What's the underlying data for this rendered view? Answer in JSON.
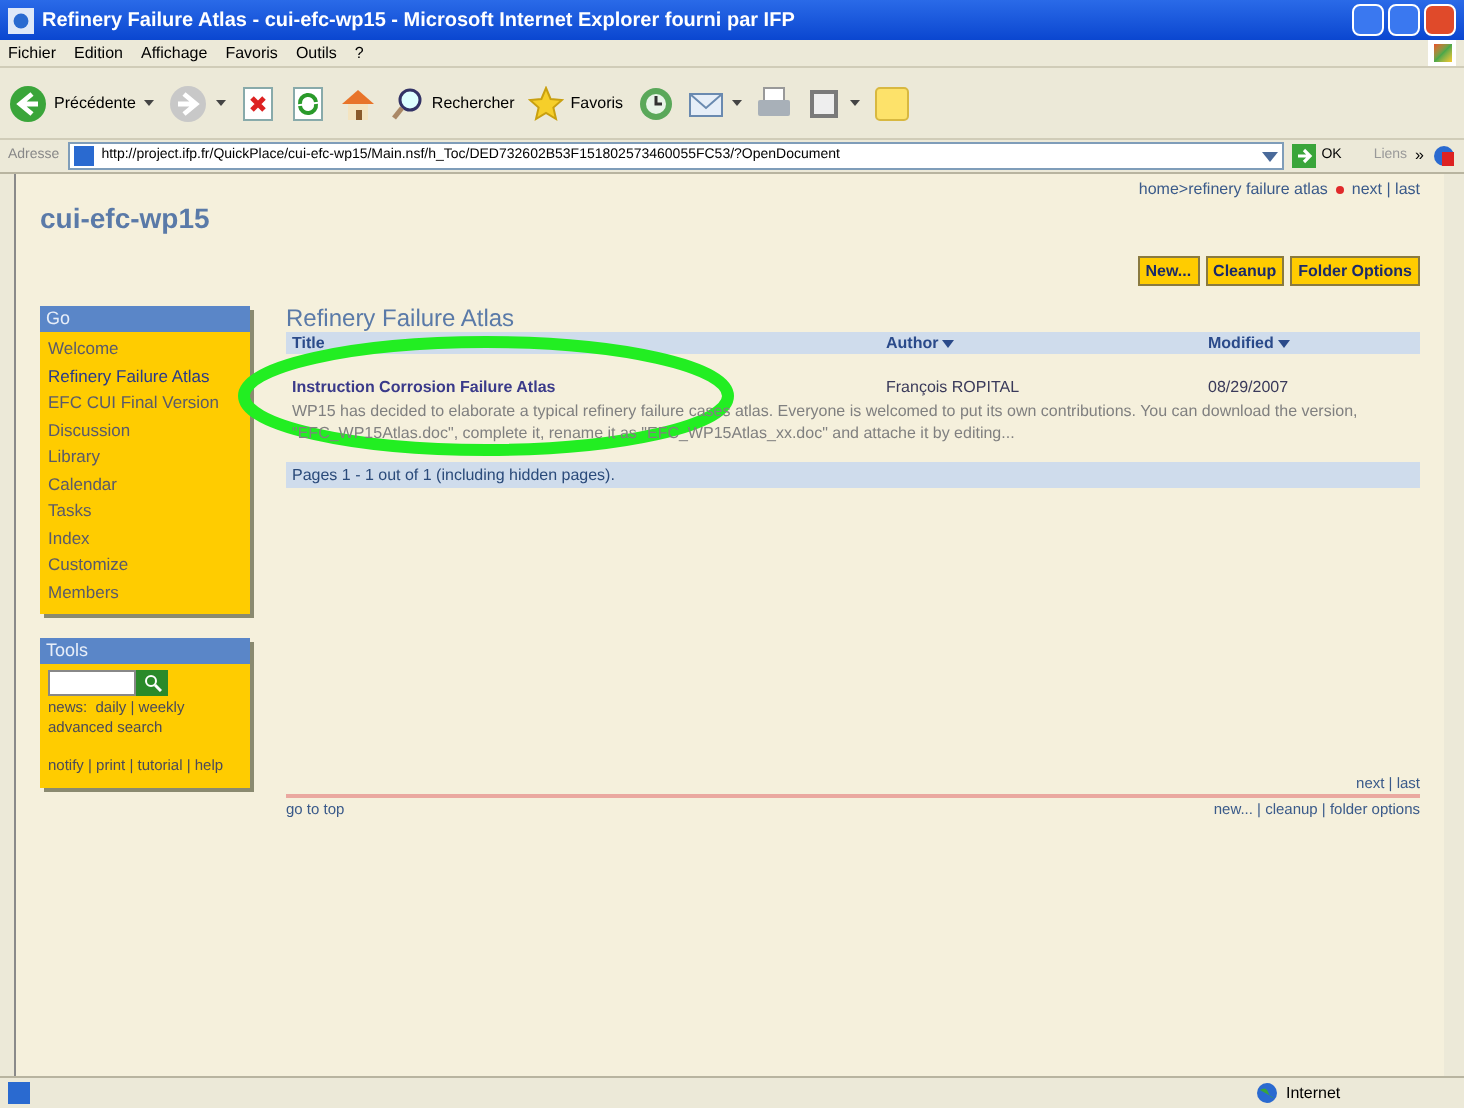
{
  "window": {
    "title": "Refinery Failure Atlas - cui-efc-wp15 - Microsoft Internet Explorer fourni par IFP"
  },
  "menu": [
    "Fichier",
    "Edition",
    "Affichage",
    "Favoris",
    "Outils",
    "?"
  ],
  "toolbar": [
    {
      "kind": "back",
      "label": "Précédente"
    },
    {
      "kind": "forward"
    },
    {
      "kind": "stop"
    },
    {
      "kind": "refresh"
    },
    {
      "kind": "home"
    },
    {
      "kind": "search",
      "label": "Rechercher"
    },
    {
      "kind": "favorites",
      "label": "Favoris"
    },
    {
      "kind": "history"
    },
    {
      "kind": "mail"
    },
    {
      "kind": "print"
    },
    {
      "kind": "word"
    },
    {
      "kind": "note"
    }
  ],
  "address": {
    "label": "Adresse",
    "value": "http://project.ifp.fr/QuickPlace/cui-efc-wp15/Main.nsf/h_Toc/DED732602B53F151802573460055FC53/?OpenDocument",
    "go": "OK",
    "links": "Liens",
    "chevron": "»"
  },
  "site_title": "cui-efc-wp15",
  "breadcrumb": {
    "path": "home>refinery failure atlas",
    "links": "next | last"
  },
  "actions": [
    "New...",
    "Cleanup",
    "Folder Options"
  ],
  "go_panel": {
    "title": "Go",
    "items": [
      {
        "label": "Welcome",
        "selected": false
      },
      {
        "label": "Refinery Failure Atlas",
        "selected": true
      },
      {
        "label": "EFC CUI Final Version",
        "selected": false
      },
      {
        "label": "Discussion",
        "selected": false
      },
      {
        "label": "Library",
        "selected": false
      },
      {
        "label": "Calendar",
        "selected": false
      },
      {
        "label": "Tasks",
        "selected": false
      },
      {
        "label": "Index",
        "selected": false
      },
      {
        "label": "Customize",
        "selected": false
      },
      {
        "label": "Members",
        "selected": false
      }
    ]
  },
  "tools_panel": {
    "title": "Tools",
    "news": "news:  daily | weekly",
    "advanced": "advanced search",
    "links": "notify | print | tutorial | help"
  },
  "folder": {
    "heading": "Refinery Failure Atlas",
    "columns": [
      "Title",
      "Author",
      "Modified"
    ],
    "rows": [
      {
        "title": "Instruction Corrosion Failure Atlas",
        "author": "François ROPITAL",
        "modified": "08/29/2007",
        "description": "WP15 has decided to elaborate a typical refinery failure cases atlas. Everyone is welcomed to put its own contributions. You can download the version, \"EFC_WP15Atlas.doc\", complete it, rename it as \"EFC_WP15Atlas_xx.doc\" and attache it by  editing..."
      }
    ],
    "pages": "Pages 1 - 1 out of 1 (including hidden pages).",
    "bottom_links": "next | last",
    "top_link": "go to top",
    "bottom_actions": "new... | cleanup | folder options"
  },
  "status_bar": {
    "zone": "Internet"
  }
}
